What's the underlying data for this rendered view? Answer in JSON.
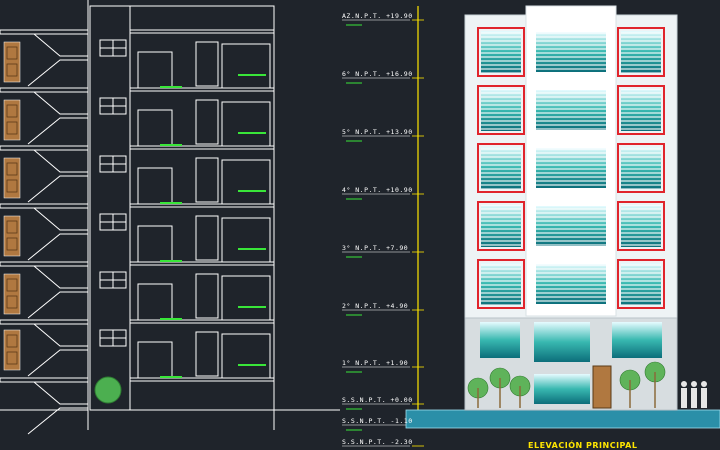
{
  "drawing": {
    "title": "ELEVACIÓN PRINCIPAL",
    "level_labels": [
      {
        "id": "azotea",
        "text": "AZ.N.P.T. +19.90"
      },
      {
        "id": "piso6",
        "text": "6° N.P.T. +16.90"
      },
      {
        "id": "piso5",
        "text": "5° N.P.T. +13.90"
      },
      {
        "id": "piso4",
        "text": "4° N.P.T. +10.90"
      },
      {
        "id": "piso3",
        "text": "3° N.P.T. +7.90"
      },
      {
        "id": "piso2",
        "text": "2° N.P.T. +4.90"
      },
      {
        "id": "piso1",
        "text": "1° N.P.T. +1.90"
      },
      {
        "id": "base",
        "text": "S.S.N.P.T. +0.00"
      },
      {
        "id": "sotano1",
        "text": "S.S.N.P.T. -1.10"
      },
      {
        "id": "sotano2",
        "text": "S.S.N.P.T. -2.30"
      }
    ]
  },
  "colors": {
    "background": "#1f242b",
    "line": "#ffffff",
    "glass": "#2aa198",
    "frame_red": "#e0242c",
    "door_wood": "#b07840",
    "text_yellow": "#ffe600",
    "tag_green": "#39e639",
    "ground_water": "#2b8fa8"
  }
}
